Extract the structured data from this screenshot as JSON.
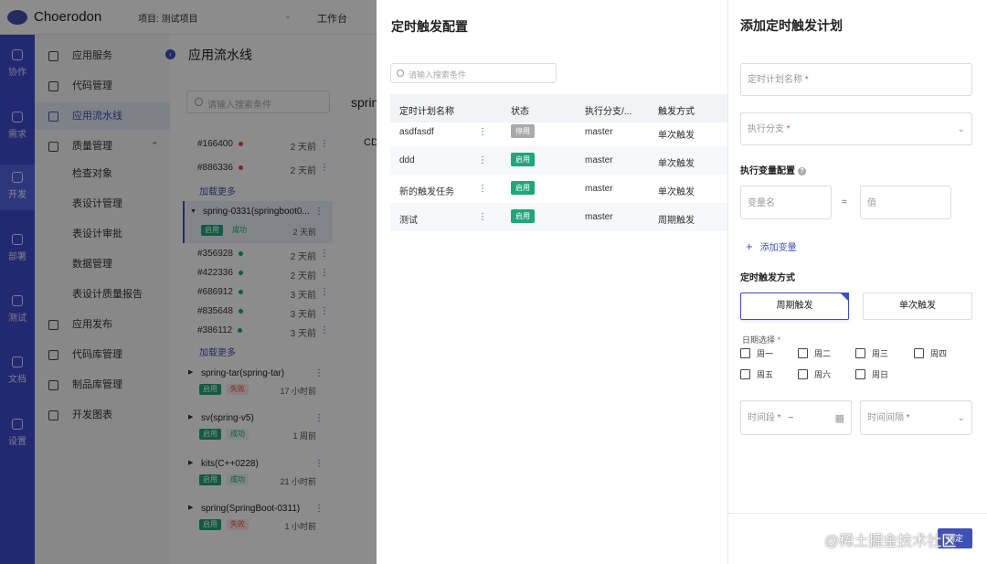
{
  "app": {
    "name": "Choerodon",
    "project": "项目: 测试项目",
    "workbench": "工作台"
  },
  "leftnav": [
    {
      "label": "协作",
      "icon": "collaborate-icon"
    },
    {
      "label": "需求",
      "icon": "layers-icon"
    },
    {
      "label": "开发",
      "icon": "code-icon"
    },
    {
      "label": "部署",
      "icon": "deploy-icon"
    },
    {
      "label": "测试",
      "icon": "clipboard-icon"
    },
    {
      "label": "文档",
      "icon": "document-icon"
    },
    {
      "label": "设置",
      "icon": "settings-icon"
    }
  ],
  "subnav": {
    "items": [
      "应用服务",
      "代码管理",
      "应用流水线",
      "质量管理"
    ],
    "quality_children": [
      "检查对象",
      "表设计管理",
      "表设计审批",
      "数据管理",
      "表设计质量报告"
    ],
    "more": [
      "应用发布",
      "代码库管理",
      "制品库管理",
      "开发图表"
    ]
  },
  "pipeline": {
    "title": "应用流水线",
    "search_placeholder": "请输入搜索条件",
    "runs_top": [
      {
        "id": "#166400",
        "time": "2 天前",
        "color": "#e74c3c"
      },
      {
        "id": "#886336",
        "time": "2 天前",
        "color": "#e74c3c"
      }
    ],
    "load_more": "加载更多",
    "active": {
      "name": "spring-0331(springboot0...",
      "enabled": "启用",
      "status": "成功",
      "time": "2 天前"
    },
    "runs_active": [
      {
        "id": "#356928",
        "time": "2 天前",
        "color": "#1fa67a"
      },
      {
        "id": "#422336",
        "time": "2 天前",
        "color": "#1fa67a"
      },
      {
        "id": "#686912",
        "time": "3 天前",
        "color": "#1fa67a"
      },
      {
        "id": "#835648",
        "time": "3 天前",
        "color": "#1fa67a"
      },
      {
        "id": "#386112",
        "time": "3 天前",
        "color": "#1fa67a"
      }
    ],
    "pipes": [
      {
        "name": "spring-tar(spring-tar)",
        "enabled": "启用",
        "status": "失败",
        "time": "17 小时前",
        "fail": true
      },
      {
        "name": "sv(spring-v5)",
        "enabled": "启用",
        "status": "成功",
        "time": "1 周前",
        "fail": false
      },
      {
        "name": "kits(C++0228)",
        "enabled": "启用",
        "status": "成功",
        "time": "21 小时前",
        "fail": false
      },
      {
        "name": "spring(SpringBoot-0311)",
        "enabled": "启用",
        "status": "失败",
        "time": "1 小时前",
        "fail": true
      }
    ],
    "detail_title": "spring",
    "cd_label": "CD"
  },
  "config": {
    "title": "定时触发配置",
    "search_placeholder": "请输入搜索条件",
    "columns": [
      "定时计划名称",
      "状态",
      "执行分支/...",
      "触发方式"
    ],
    "rows": [
      {
        "name": "asdfasdf",
        "status": "停用",
        "on": false,
        "branch": "master",
        "trigger": "单次触发"
      },
      {
        "name": "ddd",
        "status": "启用",
        "on": true,
        "branch": "master",
        "trigger": "单次触发"
      },
      {
        "name": "新的触发任务",
        "status": "启用",
        "on": true,
        "branch": "master",
        "trigger": "单次触发"
      },
      {
        "name": "测试",
        "status": "启用",
        "on": true,
        "branch": "master",
        "trigger": "周期触发"
      }
    ]
  },
  "drawer": {
    "title": "添加定时触发计划",
    "plan_name": "定时计划名称",
    "branch": "执行分支",
    "var_section": "执行变量配置",
    "var_name": "变量名",
    "eq": "=",
    "var_value": "值",
    "add_var": "添加变量",
    "trigger_section": "定时触发方式",
    "periodic": "周期触发",
    "single": "单次触发",
    "date_select": "日期选择",
    "days": [
      "周一",
      "周二",
      "周三",
      "周四",
      "周五",
      "周六",
      "周日"
    ],
    "time_range": "时间段",
    "time_range_sep": "~",
    "interval": "时间间隔",
    "required_mark": "*",
    "confirm": "确定",
    "watermark": "@稀土掘金技术社区"
  },
  "colors": {
    "primary": "#3f51b5",
    "nav": "#3f4bd0",
    "success": "#1fa67a",
    "danger": "#e74c3c"
  }
}
